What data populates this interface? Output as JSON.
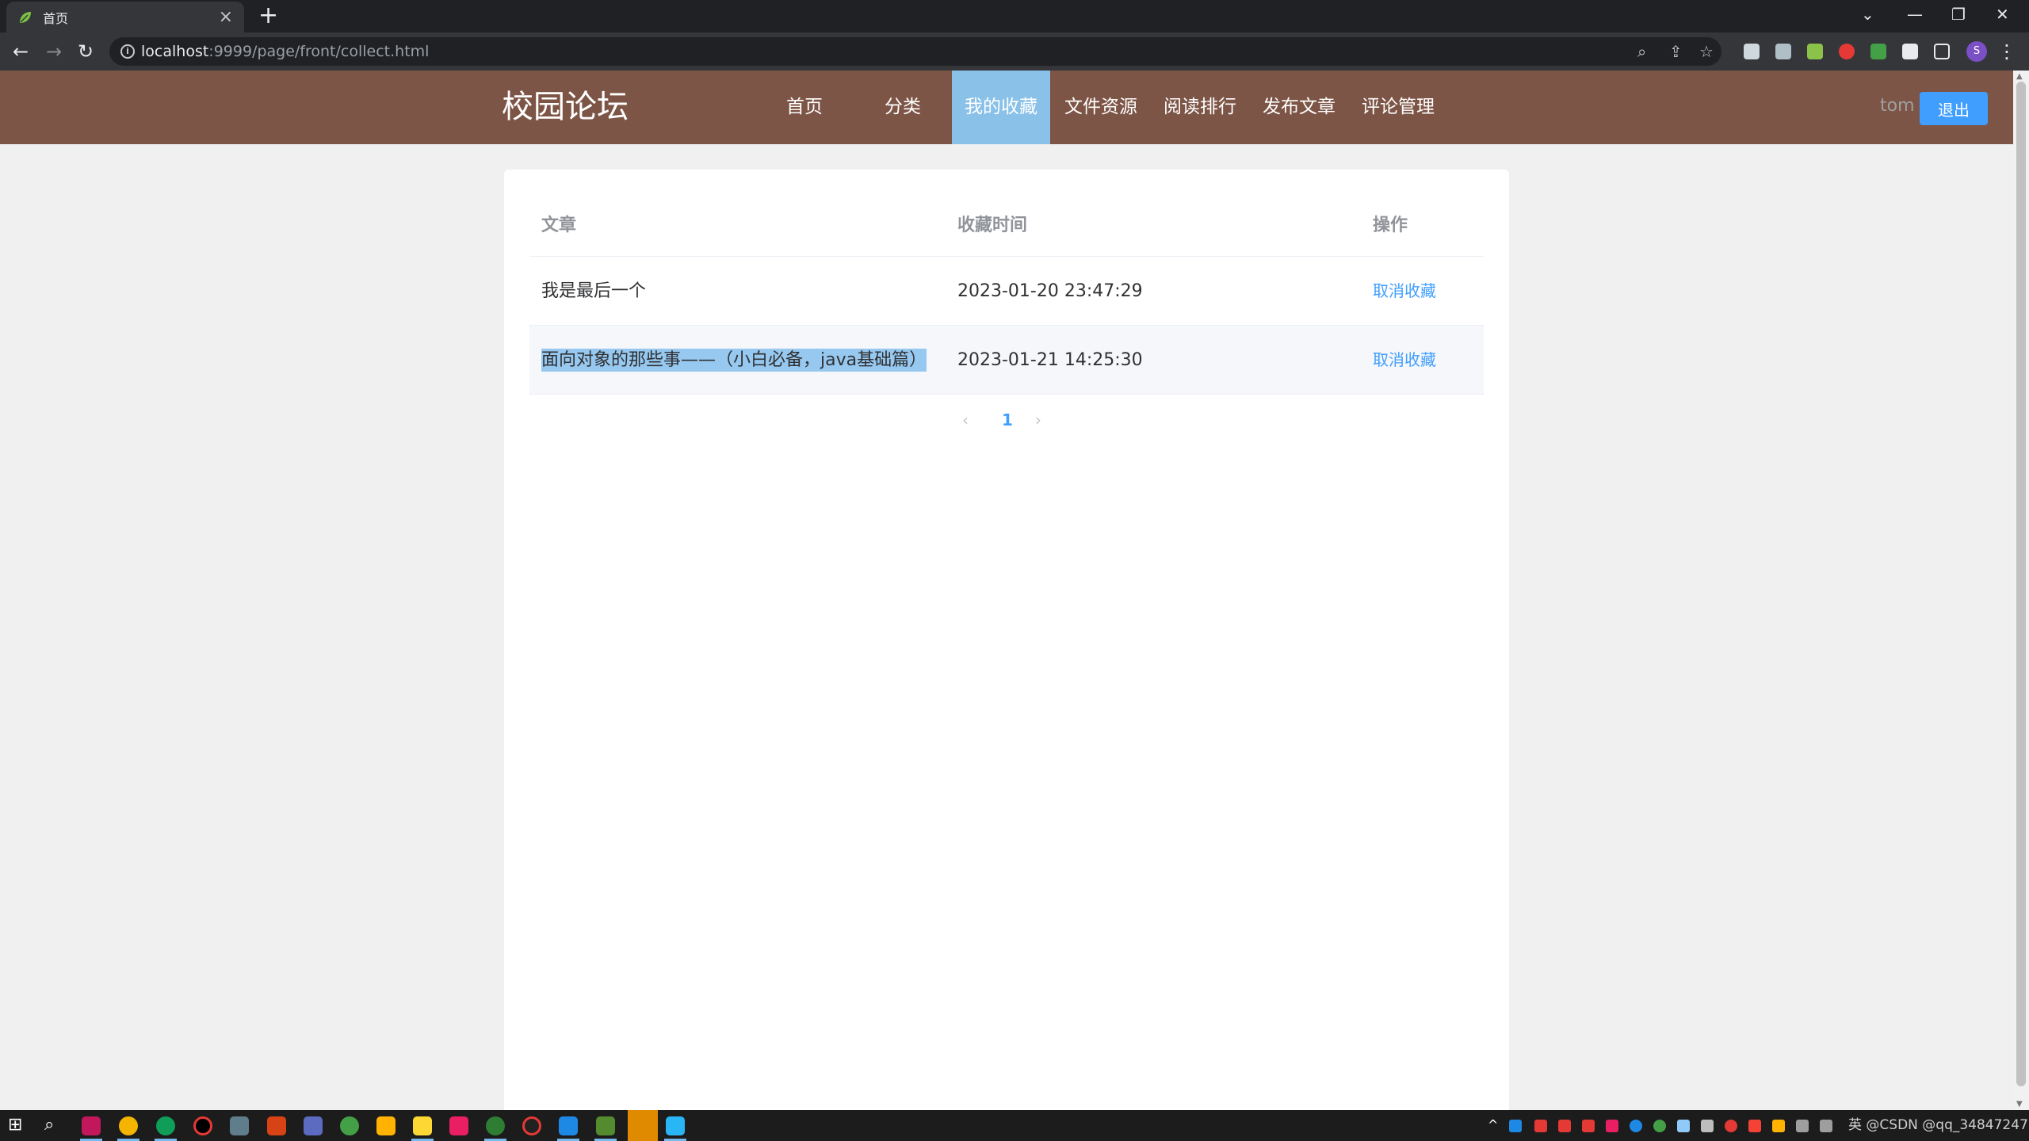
{
  "browser": {
    "tab_title": "首页",
    "url_host": "localhost",
    "url_path": ":9999/page/front/collect.html"
  },
  "header": {
    "logo": "校园论坛",
    "nav": [
      {
        "label": "首页",
        "active": false
      },
      {
        "label": "分类",
        "active": false
      },
      {
        "label": "我的收藏",
        "active": true
      },
      {
        "label": "文件资源",
        "active": false
      },
      {
        "label": "阅读排行",
        "active": false
      },
      {
        "label": "发布文章",
        "active": false
      },
      {
        "label": "评论管理",
        "active": false
      }
    ],
    "username": "tom",
    "logout_label": "退出"
  },
  "table": {
    "columns": [
      "文章",
      "收藏时间",
      "操作"
    ],
    "rows": [
      {
        "article": "我是最后一个",
        "time": "2023-01-20 23:47:29",
        "action": "取消收藏"
      },
      {
        "article": "面向对象的那些事——（小白必备，java基础篇）",
        "time": "2023-01-21 14:25:30",
        "action": "取消收藏"
      }
    ]
  },
  "pager": {
    "prev": "‹",
    "page": "1",
    "next": "›"
  },
  "taskbar": {
    "tray_text": "英 @CSDN @qq_34847247"
  },
  "colors": {
    "header_bg": "#7d5546",
    "nav_active_bg": "#89c1e8",
    "primary": "#409eff"
  }
}
